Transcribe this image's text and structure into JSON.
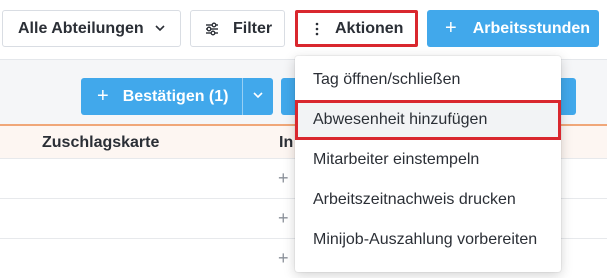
{
  "toolbar": {
    "department_select": "Alle Abteilungen",
    "filter_label": "Filter",
    "actions_label": "Aktionen",
    "hours_label": "Arbeitsstunden"
  },
  "subbar": {
    "confirm_label": "Bestätigen (1)"
  },
  "table": {
    "columns": [
      "Zuschlagskarte",
      "In"
    ]
  },
  "actions_menu": {
    "items": [
      "Tag öffnen/schließen",
      "Abwesenheit hinzufügen",
      "Mitarbeiter einstempeln",
      "Arbeitszeitnachweis drucken",
      "Minijob-Auszahlung vorbereiten"
    ],
    "highlighted": "Abwesenheit hinzufügen"
  },
  "colors": {
    "primary": "#41a8eb",
    "highlight_border": "#d9272e",
    "header_accent": "#f0a779"
  }
}
